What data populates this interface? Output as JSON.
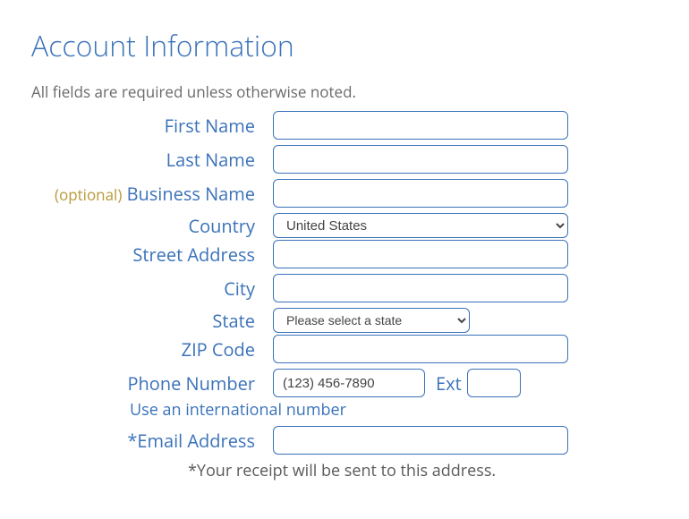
{
  "heading": "Account Information",
  "requiredNote": "All fields are required unless otherwise noted.",
  "optionalTag": "(optional)",
  "labels": {
    "firstName": "First Name",
    "lastName": "Last Name",
    "businessName": "Business Name",
    "country": "Country",
    "streetAddress": "Street Address",
    "city": "City",
    "state": "State",
    "zip": "ZIP Code",
    "phone": "Phone Number",
    "ext": "Ext",
    "email": "*Email Address"
  },
  "values": {
    "country": "United States",
    "state": "Please select a state",
    "phone": "(123) 456-7890"
  },
  "intlLink": "Use an international number",
  "receiptNote": "*Your receipt will be sent to this address."
}
